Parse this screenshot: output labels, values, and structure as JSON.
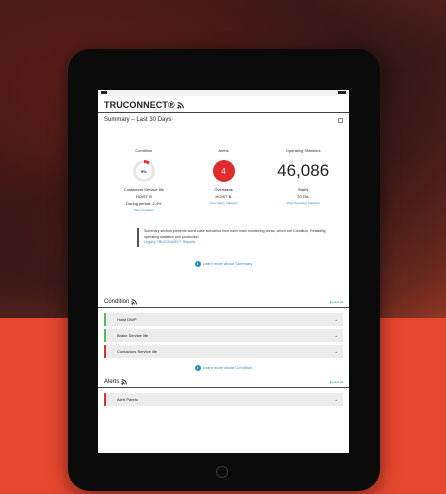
{
  "app": {
    "brand": "TRUCONNECT®"
  },
  "summary": {
    "title": "Summary – Last 30 Days",
    "condition": {
      "heading": "Condition",
      "gauge_percent": 9,
      "gauge_label": "9%",
      "line1": "Contactors Service life",
      "line2": "HOIST B",
      "line3": "During period: 2.4%",
      "link": "View Condition"
    },
    "alerts": {
      "heading": "Alerts",
      "count": "4",
      "line1": "Overloads",
      "line2": "HOIST B",
      "link": "View Safety Statistics"
    },
    "operating": {
      "heading": "Operating Statistics",
      "value": "46,086",
      "line1": "Starts",
      "line2": "TOTAL",
      "link": "View Operating Statistics"
    },
    "note_text": "Summary section presents worst case scenarios from each main monitoring areas, which are Condition, Reliability, operating statistics and production.",
    "note_link": "Legacy TRUCONNECT Reports",
    "learn_more": "Learn more about Summary"
  },
  "condition_section": {
    "title": "Condition",
    "expand": "Expand All",
    "items": [
      {
        "label": "Hoist DWP",
        "status": "green"
      },
      {
        "label": "Brake Service life",
        "status": "green"
      },
      {
        "label": "Contactors Service life",
        "status": "red"
      }
    ],
    "learn_more": "Learn more about Condition"
  },
  "alerts_section": {
    "title": "Alerts",
    "expand": "Expand All",
    "items": [
      {
        "label": "Alert Pareto",
        "status": "red"
      }
    ]
  },
  "colors": {
    "accent_blue": "#2a8fbd",
    "alert_red": "#e22b2b",
    "ok_green": "#5cb85c",
    "background_orange": "#e5472f"
  }
}
